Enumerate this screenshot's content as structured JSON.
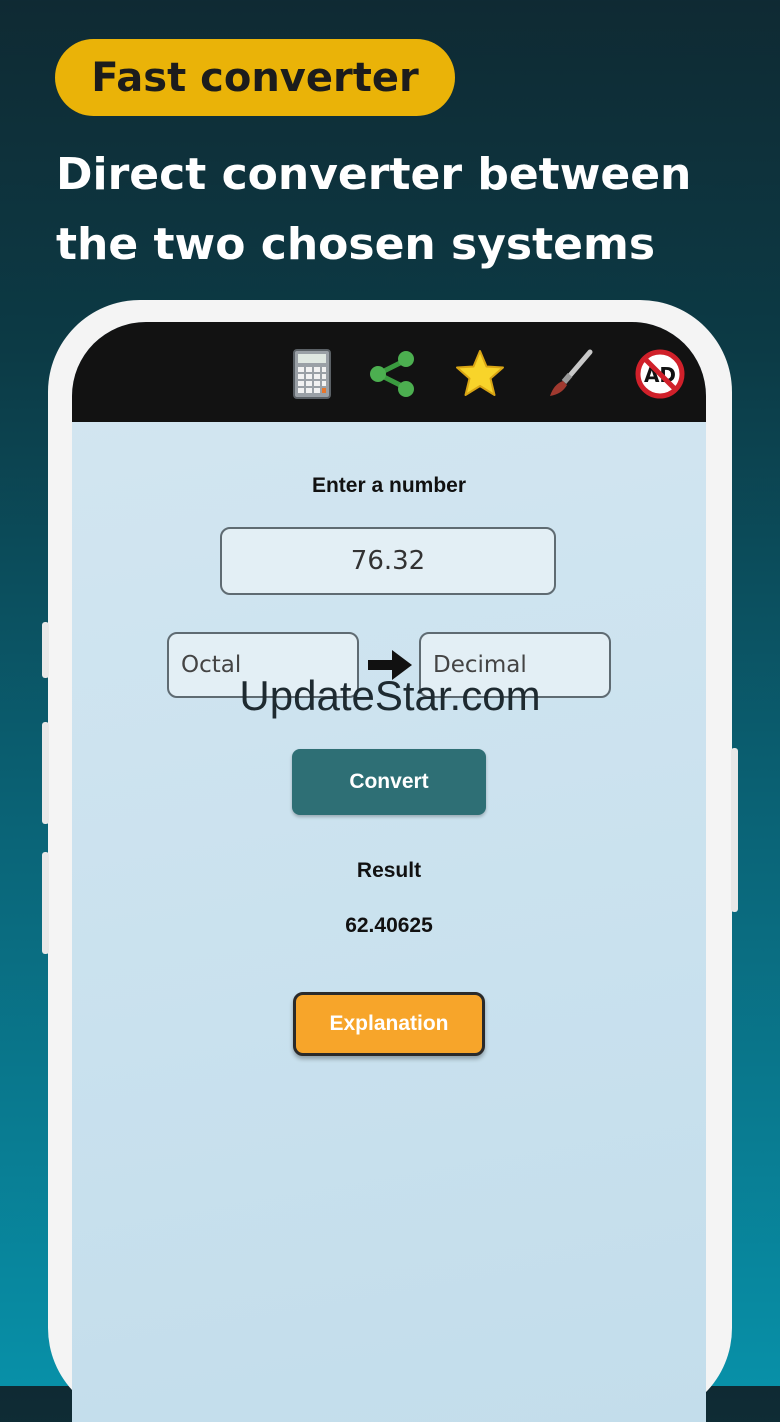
{
  "promo": {
    "badge": "Fast converter",
    "headline_line1": "Direct converter between",
    "headline_line2": "the two chosen systems"
  },
  "toolbar": {
    "icons": [
      "calculator-icon",
      "share-icon",
      "star-icon",
      "paintbrush-icon",
      "no-ads-icon"
    ],
    "no_ads_text": "AD"
  },
  "converter": {
    "prompt_label": "Enter a number",
    "input_value": "76.32",
    "from_system": "Octal",
    "to_system": "Decimal",
    "convert_label": "Convert",
    "result_label": "Result",
    "result_value": "62.40625",
    "explanation_label": "Explanation"
  },
  "watermark": "UpdateStar.com",
  "colors": {
    "badge": "#eab308",
    "convert_button": "#2e6f75",
    "explanation_button": "#f7a52a",
    "toolbar": "#121212",
    "screen": "#cfe4f0"
  }
}
